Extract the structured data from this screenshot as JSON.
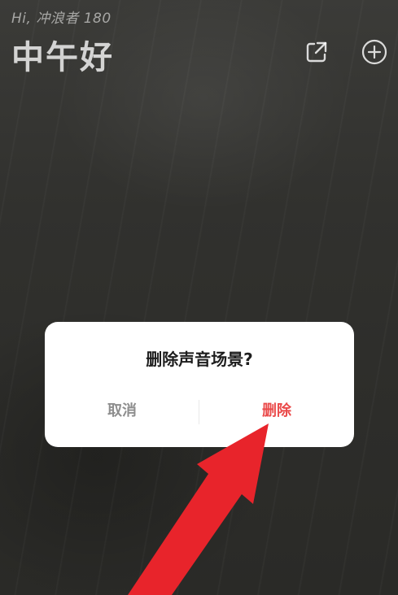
{
  "header": {
    "greeting_small": "Hi, 冲浪者 180",
    "greeting_big": "中午好"
  },
  "icons": {
    "share": "share-icon",
    "add": "plus-circle-icon"
  },
  "dialog": {
    "title": "删除声音场景?",
    "cancel_label": "取消",
    "delete_label": "删除"
  },
  "colors": {
    "background": "#2f2f2c",
    "dialog": "#ffffff",
    "delete": "#ea4a4a",
    "cancel": "#8e8e8e",
    "arrow": "#e8242b"
  }
}
